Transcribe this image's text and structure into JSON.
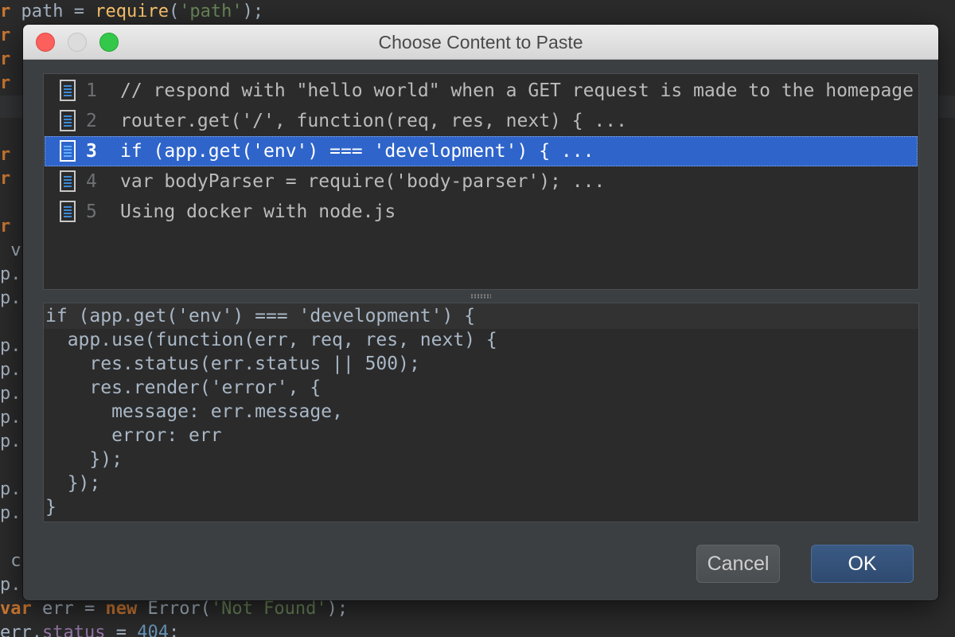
{
  "background_editor": {
    "lines": [
      {
        "segments": [
          [
            "kw",
            "r"
          ],
          [
            "plain",
            " path = "
          ],
          [
            "fn",
            "require"
          ],
          [
            "plain",
            "("
          ],
          [
            "str",
            "'path'"
          ],
          [
            "plain",
            ");"
          ]
        ]
      },
      {
        "segments": [
          [
            "kw",
            "r"
          ]
        ]
      },
      {
        "segments": [
          [
            "kw",
            "r"
          ]
        ]
      },
      {
        "segments": [
          [
            "kw",
            "r"
          ]
        ]
      },
      {
        "segments": [
          [
            "kw",
            "r"
          ]
        ]
      },
      {
        "segments": [
          [
            "kw",
            "r"
          ]
        ]
      },
      {
        "segments": [
          [
            "kw",
            "r"
          ]
        ]
      },
      {
        "segments": [
          [
            "plain",
            " v"
          ]
        ]
      },
      {
        "segments": [
          [
            "plain",
            "p."
          ]
        ]
      },
      {
        "segments": [
          [
            "plain",
            "p."
          ]
        ]
      },
      {
        "segments": [
          [
            "plain",
            "p."
          ]
        ]
      },
      {
        "segments": [
          [
            "plain",
            "p."
          ]
        ]
      },
      {
        "segments": [
          [
            "plain",
            "p."
          ]
        ]
      },
      {
        "segments": [
          [
            "plain",
            "p."
          ]
        ]
      },
      {
        "segments": [
          [
            "plain",
            "p."
          ]
        ]
      },
      {
        "segments": [
          [
            "plain",
            "p."
          ]
        ]
      },
      {
        "segments": [
          [
            "plain",
            "p."
          ]
        ]
      },
      {
        "segments": [
          [
            "plain",
            " c"
          ]
        ]
      },
      {
        "segments": [
          [
            "plain",
            "p."
          ]
        ]
      },
      {
        "segments": [
          [
            "kw",
            "var"
          ],
          [
            "plain",
            " err = "
          ],
          [
            "kw",
            "new"
          ],
          [
            "plain",
            " Error("
          ],
          [
            "str",
            "'Not Found'"
          ],
          [
            "plain",
            ");"
          ]
        ]
      },
      {
        "segments": [
          [
            "plain",
            "err."
          ],
          [
            "prop",
            "status"
          ],
          [
            "plain",
            " = "
          ],
          [
            "num",
            "404"
          ],
          [
            "plain",
            ";"
          ]
        ]
      }
    ]
  },
  "dialog": {
    "title": "Choose Content to Paste",
    "items": [
      {
        "num": "1",
        "text": "// respond with \"hello world\" when a GET request is made to the homepage"
      },
      {
        "num": "2",
        "text": "router.get('/', function(req, res, next) { ..."
      },
      {
        "num": "3",
        "text": "if (app.get('env') === 'development') { ...",
        "selected": true
      },
      {
        "num": "4",
        "text": "var bodyParser = require('body-parser'); ..."
      },
      {
        "num": "5",
        "text": "Using docker with node.js"
      }
    ],
    "preview_lines": [
      "if (app.get('env') === 'development') {",
      "  app.use(function(err, req, res, next) {",
      "    res.status(err.status || 500);",
      "    res.render('error', {",
      "      message: err.message,",
      "      error: err",
      "    });",
      "  });",
      "}"
    ],
    "cancel_label": "Cancel",
    "ok_label": "OK"
  },
  "colors": {
    "selection": "#2f65ca",
    "panel_bg": "#2b2b2b",
    "dialog_bg": "#3c3f41",
    "ok_button": "#2f4a70"
  }
}
